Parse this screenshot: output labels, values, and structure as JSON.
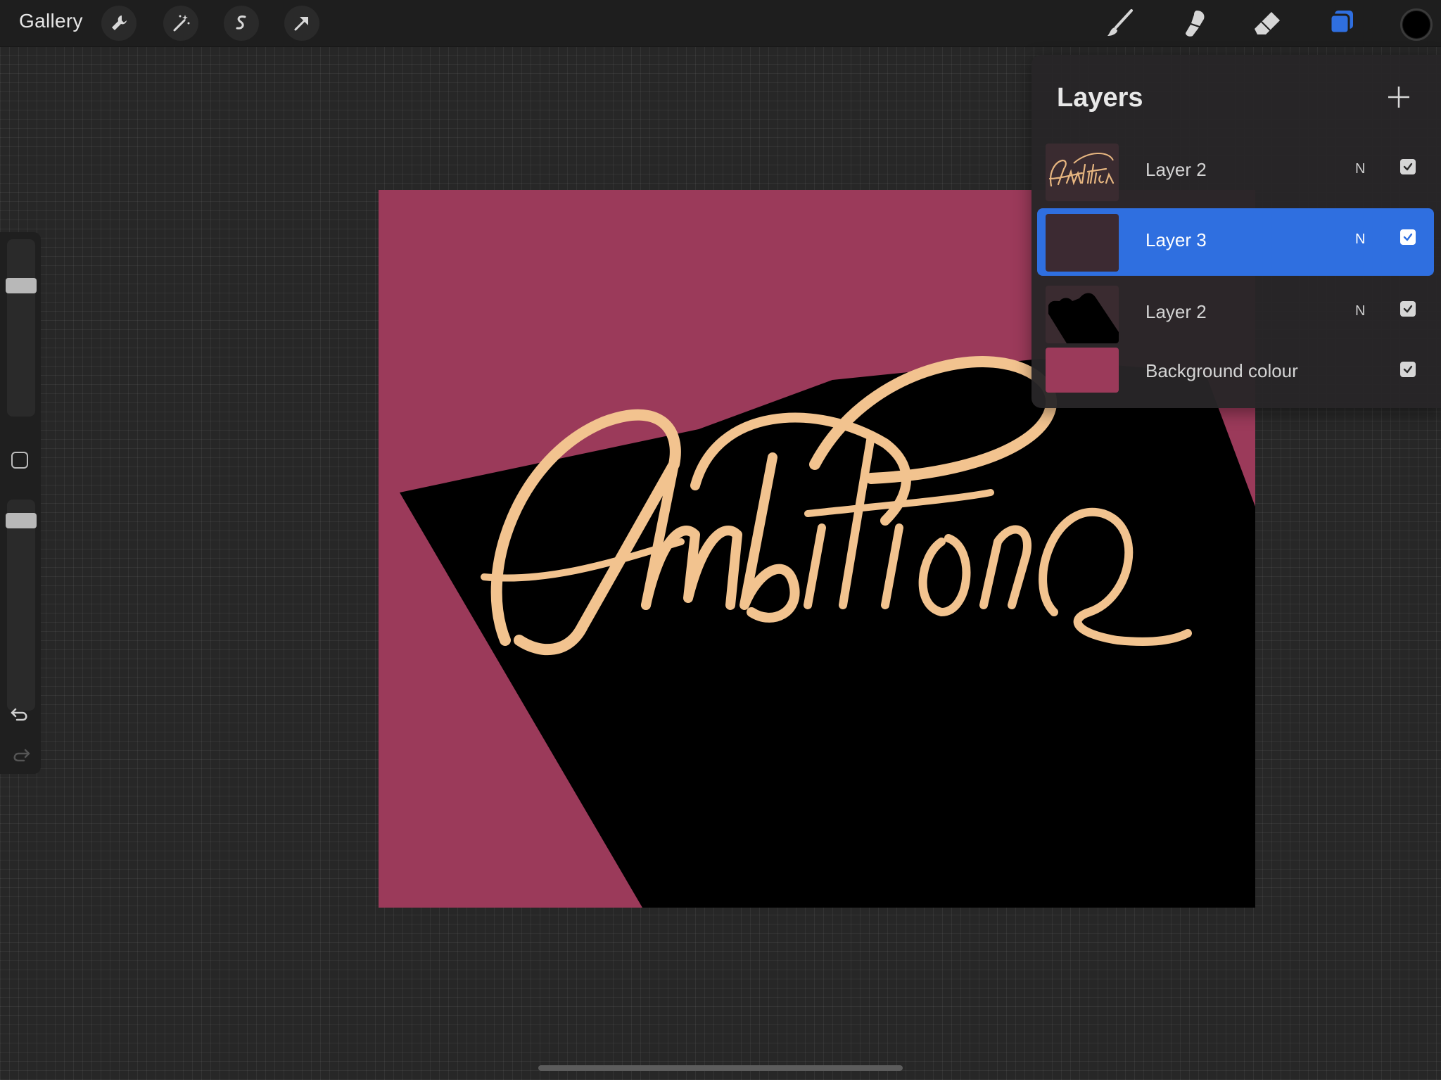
{
  "app": {
    "gallery_label": "Gallery"
  },
  "toolbar": {
    "left_icons": [
      "wrench-icon",
      "magic-wand-icon",
      "selection-s-icon",
      "transform-arrow-icon"
    ],
    "right_icons": [
      "brush-icon",
      "smudge-icon",
      "eraser-icon",
      "layers-icon"
    ],
    "active_tool": "layers-icon",
    "active_color": "#000000",
    "accent_color": "#2f6fe0"
  },
  "sidebar": {
    "brush_size_level": 0.76,
    "opacity_level": 0.93,
    "icons": [
      "modify-square-icon",
      "undo-icon",
      "redo-icon"
    ]
  },
  "canvas": {
    "background_color": "#9b3a5a",
    "shadow_color": "#000000",
    "lettering_color": "#f2c38f",
    "lettering_text": "Ambitiono"
  },
  "layers": {
    "title": "Layers",
    "add_icon": "plus-icon",
    "items": [
      {
        "name": "Layer 2",
        "mode": "N",
        "visible": true,
        "selected": false,
        "thumb": "lettering"
      },
      {
        "name": "Layer 3",
        "mode": "N",
        "visible": true,
        "selected": true,
        "thumb": "dark"
      },
      {
        "name": "Layer 2",
        "mode": "N",
        "visible": true,
        "selected": false,
        "thumb": "shadow"
      },
      {
        "name": "Background colour",
        "mode": "",
        "visible": true,
        "selected": false,
        "thumb": "color"
      }
    ]
  }
}
